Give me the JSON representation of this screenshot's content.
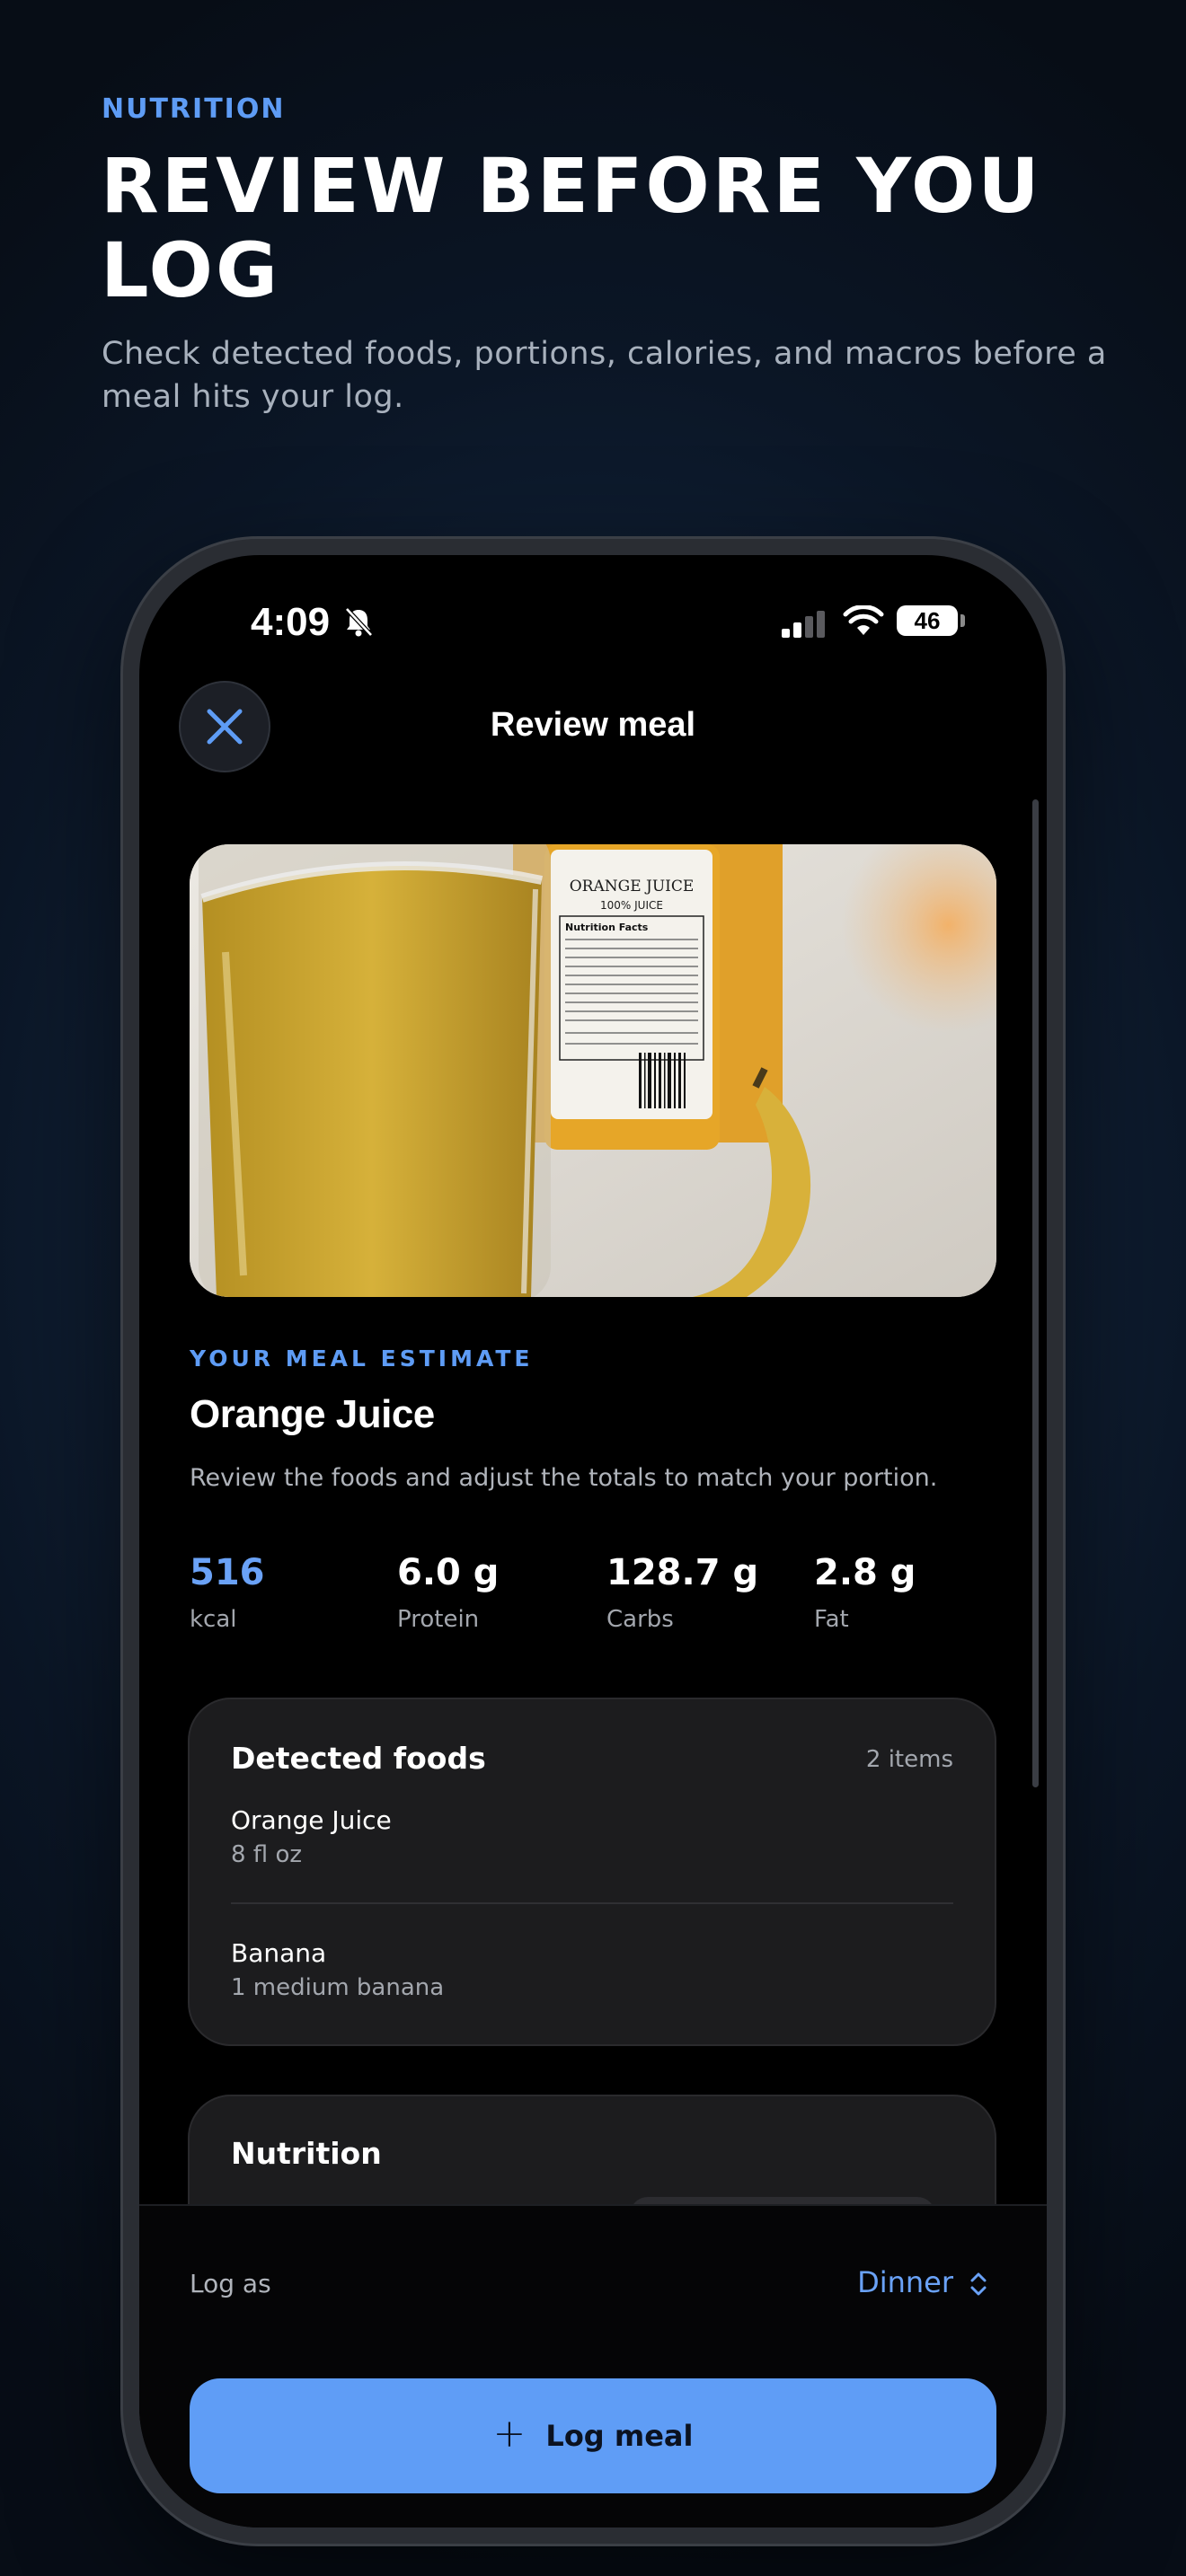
{
  "header": {
    "eyebrow": "NUTRITION",
    "headline": "REVIEW BEFORE YOU LOG",
    "subhead": "Check detected foods, portions, calories, and macros before a meal hits your log."
  },
  "status_bar": {
    "time": "4:09",
    "battery": "46"
  },
  "nav": {
    "title": "Review meal",
    "close_icon": "close-icon"
  },
  "estimate": {
    "label": "YOUR MEAL ESTIMATE",
    "meal_name": "Orange Juice",
    "description": "Review the foods and adjust the totals to match your portion.",
    "macros": [
      {
        "value": "516",
        "label": "kcal"
      },
      {
        "value": "6.0 g",
        "label": "Protein"
      },
      {
        "value": "128.7 g",
        "label": "Carbs"
      },
      {
        "value": "2.8 g",
        "label": "Fat"
      }
    ]
  },
  "photo_label": {
    "brand": "ORANGE JUICE",
    "sub": "100% JUICE",
    "facts": "Nutrition Facts"
  },
  "detected_foods": {
    "title": "Detected foods",
    "count": "2 items",
    "items": [
      {
        "name": "Orange Juice",
        "portion": "8 fl oz"
      },
      {
        "name": "Banana",
        "portion": "1 medium banana"
      }
    ]
  },
  "nutrition": {
    "title": "Nutrition"
  },
  "log_bar": {
    "log_as_label": "Log as",
    "meal_type": "Dinner",
    "button_label": "Log meal"
  },
  "colors": {
    "accent": "#5e9cf5",
    "button": "#5f9df6",
    "card": "#1c1c1e"
  }
}
